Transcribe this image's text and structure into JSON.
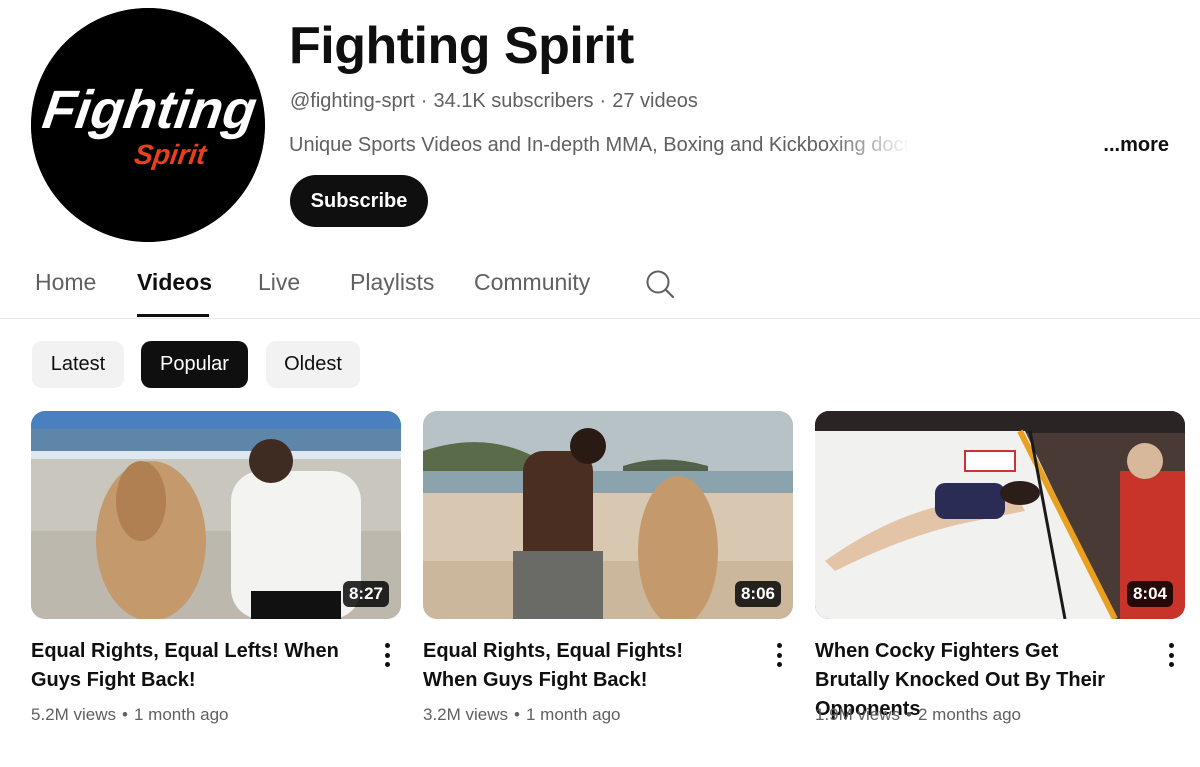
{
  "channel": {
    "name": "Fighting Spirit",
    "logo_text_top": "Fighting",
    "logo_text_bottom": "Spirit",
    "handle": "@fighting-sprt",
    "subscribers": "34.1K subscribers",
    "videos_count": "27 videos",
    "description": "Unique Sports Videos and In-depth MMA, Boxing and Kickboxing documentaries brought t",
    "more_label": "...more",
    "subscribe_label": "Subscribe"
  },
  "tabs": [
    {
      "label": "Home",
      "active": false
    },
    {
      "label": "Videos",
      "active": true
    },
    {
      "label": "Live",
      "active": false
    },
    {
      "label": "Playlists",
      "active": false
    },
    {
      "label": "Community",
      "active": false
    }
  ],
  "chips": [
    {
      "label": "Latest",
      "active": false
    },
    {
      "label": "Popular",
      "active": true
    },
    {
      "label": "Oldest",
      "active": false
    }
  ],
  "videos": [
    {
      "title": "Equal Rights, Equal Lefts! When Guys Fight Back!",
      "duration": "8:27",
      "views": "5.2M views",
      "age": "1 month ago"
    },
    {
      "title": "Equal Rights, Equal Fights! When Guys Fight Back!",
      "duration": "8:06",
      "views": "3.2M views",
      "age": "1 month ago"
    },
    {
      "title": "When Cocky Fighters Get Brutally Knocked Out By Their Opponents",
      "duration": "8:04",
      "views": "1.9M views",
      "age": "2 months ago"
    }
  ],
  "colors": {
    "accent": "#0f0f0f",
    "secondary_text": "#606060",
    "chip_bg": "#f2f2f2",
    "logo_red": "#e8401c"
  },
  "icons": {
    "search": "search-icon",
    "more_actions": "more-vert-icon"
  }
}
